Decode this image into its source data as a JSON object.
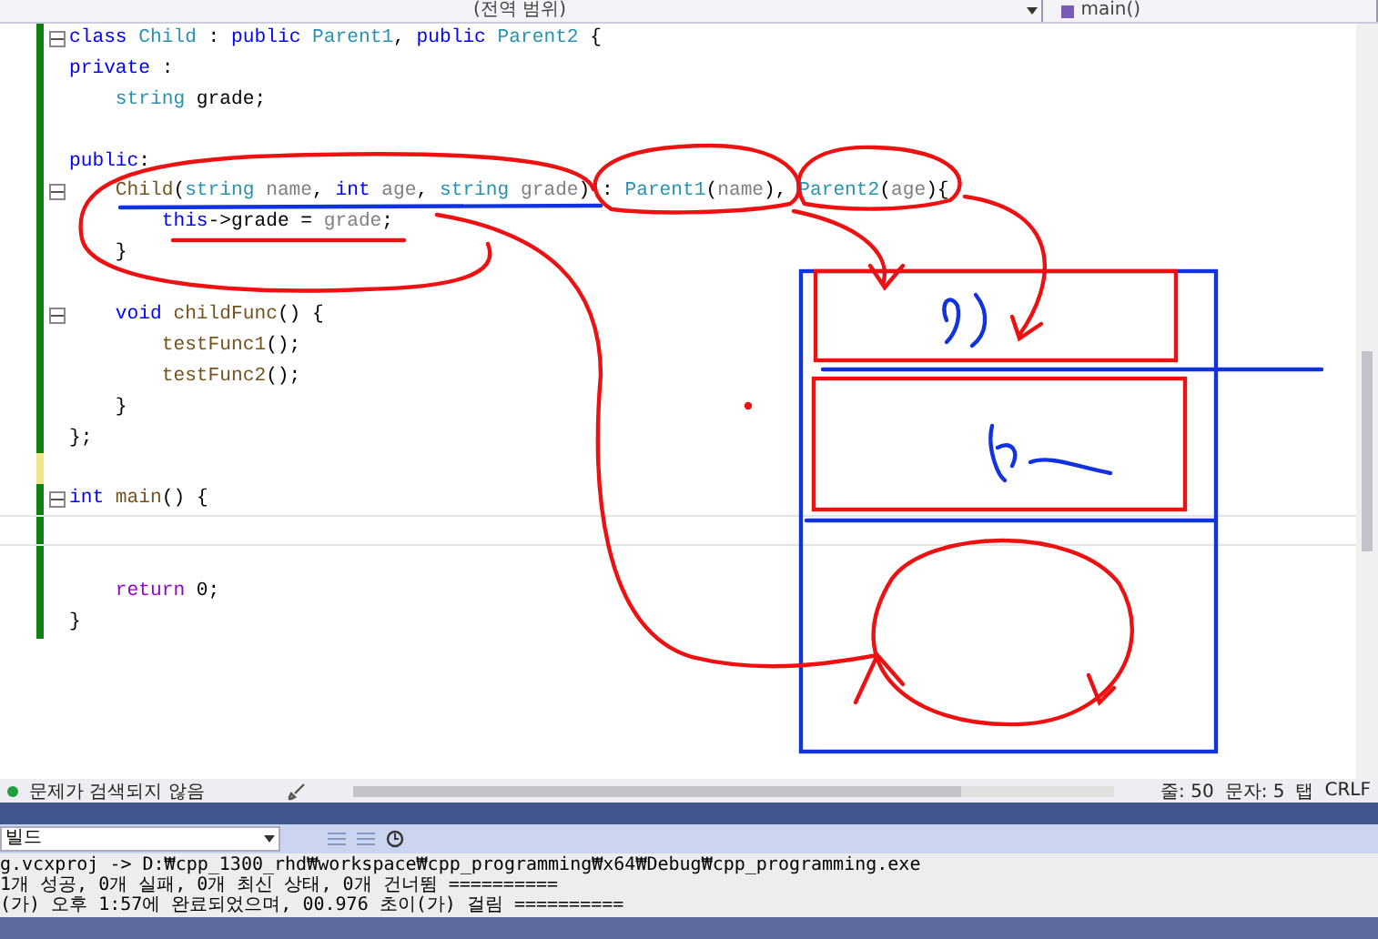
{
  "navigation_bar": {
    "scope": "(전역 범위)",
    "member": "main()"
  },
  "code_editor": {
    "lines": [
      {
        "saved": true,
        "fold": true,
        "current": false,
        "tokens": [
          {
            "kind": "keyword",
            "text": "class"
          },
          {
            "kind": "type",
            "text": " Child"
          },
          {
            "kind": "plain",
            "text": " : "
          },
          {
            "kind": "keyword",
            "text": "public"
          },
          {
            "kind": "type",
            "text": " Parent1"
          },
          {
            "kind": "plain",
            "text": ", "
          },
          {
            "kind": "keyword",
            "text": "public"
          },
          {
            "kind": "type",
            "text": " Parent2"
          },
          {
            "kind": "plain",
            "text": " {"
          }
        ]
      },
      {
        "saved": true,
        "fold": false,
        "current": false,
        "tokens": [
          {
            "kind": "keyword",
            "text": "private"
          },
          {
            "kind": "plain",
            "text": " :"
          }
        ]
      },
      {
        "saved": true,
        "fold": false,
        "current": false,
        "tokens": [
          {
            "kind": "type",
            "text": "    string"
          },
          {
            "kind": "plain",
            "text": " grade;"
          }
        ]
      },
      {
        "saved": true,
        "fold": false,
        "current": false
      },
      {
        "saved": true,
        "fold": false,
        "current": false,
        "tokens": [
          {
            "kind": "keyword",
            "text": "public"
          },
          {
            "kind": "plain",
            "text": ":"
          }
        ]
      },
      {
        "saved": true,
        "fold": true,
        "current": false,
        "tokens": [
          {
            "kind": "func",
            "text": "    Child"
          },
          {
            "kind": "plain",
            "text": "("
          },
          {
            "kind": "type",
            "text": "string"
          },
          {
            "kind": "param",
            "text": " name"
          },
          {
            "kind": "plain",
            "text": ", "
          },
          {
            "kind": "keyword",
            "text": "int"
          },
          {
            "kind": "param",
            "text": " age"
          },
          {
            "kind": "plain",
            "text": ", "
          },
          {
            "kind": "type",
            "text": "string"
          },
          {
            "kind": "param",
            "text": " grade"
          },
          {
            "kind": "plain",
            "text": ") : "
          },
          {
            "kind": "type",
            "text": "Parent1"
          },
          {
            "kind": "plain",
            "text": "("
          },
          {
            "kind": "param",
            "text": "name"
          },
          {
            "kind": "plain",
            "text": "), "
          },
          {
            "kind": "type",
            "text": "Parent2"
          },
          {
            "kind": "plain",
            "text": "("
          },
          {
            "kind": "param",
            "text": "age"
          },
          {
            "kind": "plain",
            "text": "){"
          }
        ]
      },
      {
        "saved": true,
        "fold": false,
        "current": false,
        "tokens": [
          {
            "kind": "keyword",
            "text": "        this"
          },
          {
            "kind": "plain",
            "text": "->grade = "
          },
          {
            "kind": "param",
            "text": "grade"
          },
          {
            "kind": "plain",
            "text": ";"
          }
        ]
      },
      {
        "saved": true,
        "fold": false,
        "current": false,
        "tokens": [
          {
            "kind": "plain",
            "text": "    }"
          }
        ]
      },
      {
        "saved": true,
        "fold": false,
        "current": false
      },
      {
        "saved": true,
        "fold": true,
        "current": false,
        "tokens": [
          {
            "kind": "keyword",
            "text": "    void"
          },
          {
            "kind": "func",
            "text": " childFunc"
          },
          {
            "kind": "plain",
            "text": "() {"
          }
        ]
      },
      {
        "saved": true,
        "fold": false,
        "current": false,
        "tokens": [
          {
            "kind": "func",
            "text": "        testFunc1"
          },
          {
            "kind": "plain",
            "text": "();"
          }
        ]
      },
      {
        "saved": true,
        "fold": false,
        "current": false,
        "tokens": [
          {
            "kind": "func",
            "text": "        testFunc2"
          },
          {
            "kind": "plain",
            "text": "();"
          }
        ]
      },
      {
        "saved": true,
        "fold": false,
        "current": false,
        "tokens": [
          {
            "kind": "plain",
            "text": "    }"
          }
        ]
      },
      {
        "saved": true,
        "fold": false,
        "current": false,
        "tokens": [
          {
            "kind": "plain",
            "text": "};"
          }
        ]
      },
      {
        "saved": false,
        "fold": false,
        "current": false
      },
      {
        "saved": true,
        "fold": true,
        "current": false,
        "tokens": [
          {
            "kind": "keyword",
            "text": "int"
          },
          {
            "kind": "func",
            "text": " main"
          },
          {
            "kind": "plain",
            "text": "() {"
          }
        ]
      },
      {
        "saved": true,
        "fold": false,
        "current": true
      },
      {
        "saved": true,
        "fold": false,
        "current": false
      },
      {
        "saved": true,
        "fold": false,
        "current": false,
        "tokens": [
          {
            "kind": "control",
            "text": "    return"
          },
          {
            "kind": "plain",
            "text": " 0;"
          }
        ]
      },
      {
        "saved": true,
        "fold": false,
        "current": false,
        "tokens": [
          {
            "kind": "plain",
            "text": "}"
          }
        ]
      }
    ]
  },
  "status_bar": {
    "issues": "문제가 검색되지 않음",
    "line": "줄: 50",
    "column": "문자: 5",
    "indent": "탭",
    "line_ending": "CRLF"
  },
  "output_panel": {
    "source": "빌드",
    "lines": [
      "g.vcxproj -> D:₩cpp_1300_rhd₩workspace₩cpp_programming₩x64₩Debug₩cpp_programming.exe",
      "1개 성공, 0개 실패, 0개 최신 상태, 0개 건너뜀 ==========",
      "(가) 오후 1:57에 완료되었으며, 00.976 초이(가) 걸림 =========="
    ]
  }
}
